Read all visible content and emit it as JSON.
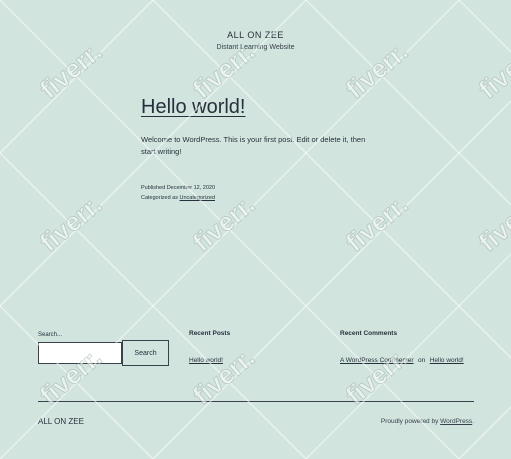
{
  "header": {
    "site_title": "ALL ON ZEE",
    "site_description": "Distant Learning Website"
  },
  "post": {
    "title": "Hello world!",
    "body": "Welcome to WordPress. This is your first post. Edit or delete it, then start writing!",
    "published_label": "Published",
    "published_date": "December 12, 2020",
    "categorized_label": "Categorized as",
    "category": "Uncategorized"
  },
  "widgets": {
    "search": {
      "label": "Search...",
      "input_value": "",
      "button_label": "Search"
    },
    "recent_posts": {
      "title": "Recent Posts",
      "items": [
        "Hello world!"
      ]
    },
    "recent_comments": {
      "title": "Recent Comments",
      "author": "A WordPress Commenter",
      "connector": "on",
      "post": "Hello world!"
    }
  },
  "footer": {
    "site_title": "ALL ON ZEE",
    "powered_prefix": "Proudly powered by",
    "powered_link": "WordPress",
    "powered_suffix": "."
  },
  "watermark": {
    "text": "fiverr."
  },
  "colors": {
    "background": "#d1e4dd",
    "text": "#28303d",
    "border": "#39414d"
  }
}
